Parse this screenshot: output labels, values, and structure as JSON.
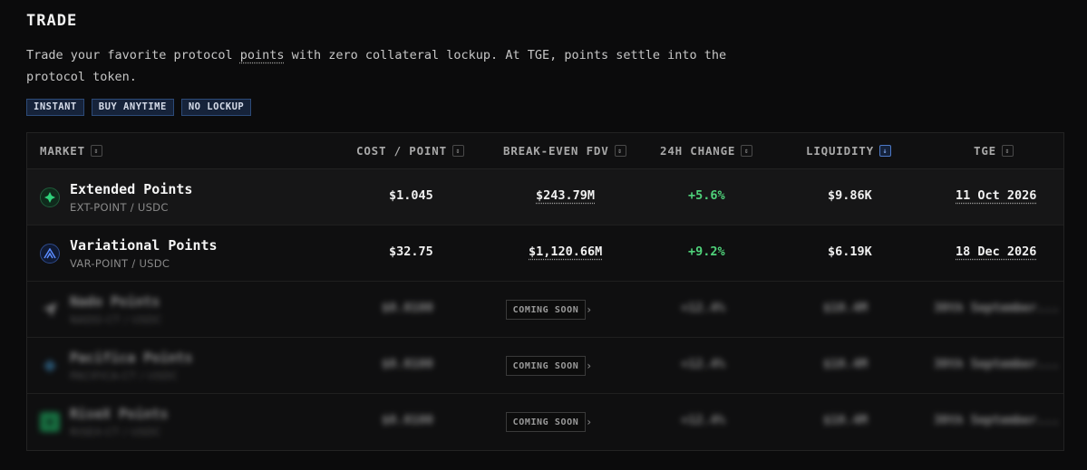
{
  "page": {
    "title": "TRADE",
    "description_pre": "Trade your favorite protocol ",
    "description_link": "points",
    "description_post": " with zero collateral lockup. At TGE, points settle into the protocol token.",
    "tags": [
      "INSTANT",
      "BUY ANYTIME",
      "NO LOCKUP"
    ]
  },
  "table": {
    "headers": {
      "market": "MARKET",
      "cost": "COST / POINT",
      "fdv": "BREAK-EVEN FDV",
      "change": "24H CHANGE",
      "liquidity": "LIQUIDITY",
      "tge": "TGE"
    },
    "rows": [
      {
        "name": "Extended Points",
        "pair": "EXT-POINT / USDC",
        "cost": "$1.045",
        "fdv": "$243.79M",
        "change": "+5.6%",
        "liquidity": "$9.86K",
        "tge": "11 Oct 2026",
        "logo_icon": "extended-logo-icon",
        "logo_color": "#2fd07a"
      },
      {
        "name": "Variational Points",
        "pair": "VAR-POINT / USDC",
        "cost": "$32.75",
        "fdv": "$1,120.66M",
        "change": "+9.2%",
        "liquidity": "$6.19K",
        "tge": "18 Dec 2026",
        "logo_icon": "variational-logo-icon",
        "logo_color": "#4f7dff"
      }
    ],
    "coming_soon_rows": [
      {
        "name": "Nado Points",
        "pair": "NADO-CT / USDC",
        "cost": "$0.0100",
        "change": "+12.4%",
        "liquidity": "$10.4M",
        "tge": "30th September...",
        "badge": "COMING SOON"
      },
      {
        "name": "Pacifica Points",
        "pair": "PACIFICA-CT / USDC",
        "cost": "$0.0100",
        "change": "+12.4%",
        "liquidity": "$10.4M",
        "tge": "30th September...",
        "badge": "COMING SOON"
      },
      {
        "name": "RiseX Points",
        "pair": "RISEX-CT / USDC",
        "cost": "$0.0100",
        "change": "+12.4%",
        "liquidity": "$10.4M",
        "tge": "30th September...",
        "badge": "COMING SOON"
      }
    ]
  },
  "colors": {
    "accent_blue": "#4d79c7",
    "positive": "#4fd27a",
    "background": "#0b0b0c"
  }
}
